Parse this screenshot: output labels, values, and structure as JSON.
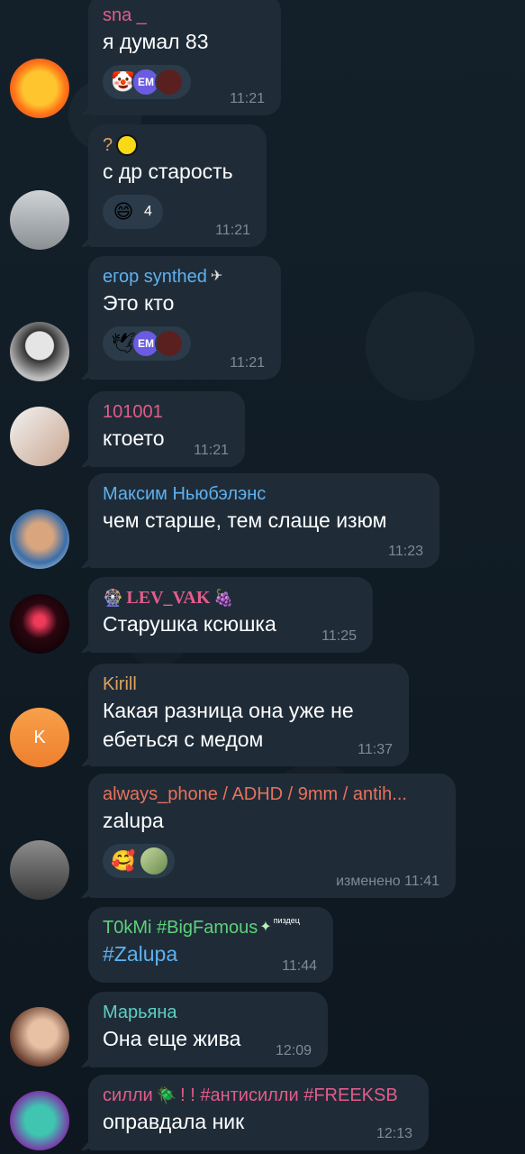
{
  "messages": [
    {
      "name": "sna _",
      "name_color": "#e35c8a",
      "text": "я думал 83",
      "time": "11:21",
      "reactions": [
        {
          "emoji": "🤡",
          "avatars": [
            "EM",
            "img"
          ]
        }
      ]
    },
    {
      "name": "?",
      "name_color": "#e0a15f",
      "text": "с др старость",
      "time": "11:21",
      "reactions": [
        {
          "emoji": "😄",
          "count": "4"
        }
      ]
    },
    {
      "name": "егор synthed",
      "name_color": "#5fb1ef",
      "text": "Это кто",
      "time": "11:21",
      "reactions": [
        {
          "emoji": "🕊",
          "avatars": [
            "EM",
            "img"
          ]
        }
      ]
    },
    {
      "name": "101001",
      "name_color": "#e35c8a",
      "text": "ктоето",
      "time": "11:21"
    },
    {
      "name": "Максим Ньюбэлэнс",
      "name_color": "#5fb1ef",
      "text": "чем старше, тем слаще изюм",
      "time": "11:23"
    },
    {
      "name": "LEV_VAK",
      "name_color": "#e35c8a",
      "text": "Старушка ксюшка",
      "time": "11:25"
    },
    {
      "name": "Kirill",
      "name_color": "#e0a15f",
      "text_lines": [
        "Какая разница она уже не",
        "ебеться с медом"
      ],
      "time": "11:37",
      "avatar_letter": "K"
    },
    {
      "name": "always_phone / ADHD / 9mm / antih...",
      "name_color": "#e8725b",
      "text": "zalupa",
      "time": "изменено 11:41",
      "reactions": [
        {
          "emoji": "🥰"
        },
        {
          "emoji": "img"
        }
      ]
    },
    {
      "name": "T0kMi #BigFamous",
      "name_color": "#5fd07a",
      "text": "#Zalupa",
      "time": "11:44",
      "badge": "пиздец"
    },
    {
      "name": "Марьяна",
      "name_color": "#5fcfc3",
      "text": "Она еще жива",
      "time": "12:09"
    },
    {
      "name": "силли",
      "name_color": "#e35c8a",
      "name_suffix": "! ! #антисилли #FREEKSB",
      "text": "оправдала ник",
      "time": "12:13"
    }
  ]
}
